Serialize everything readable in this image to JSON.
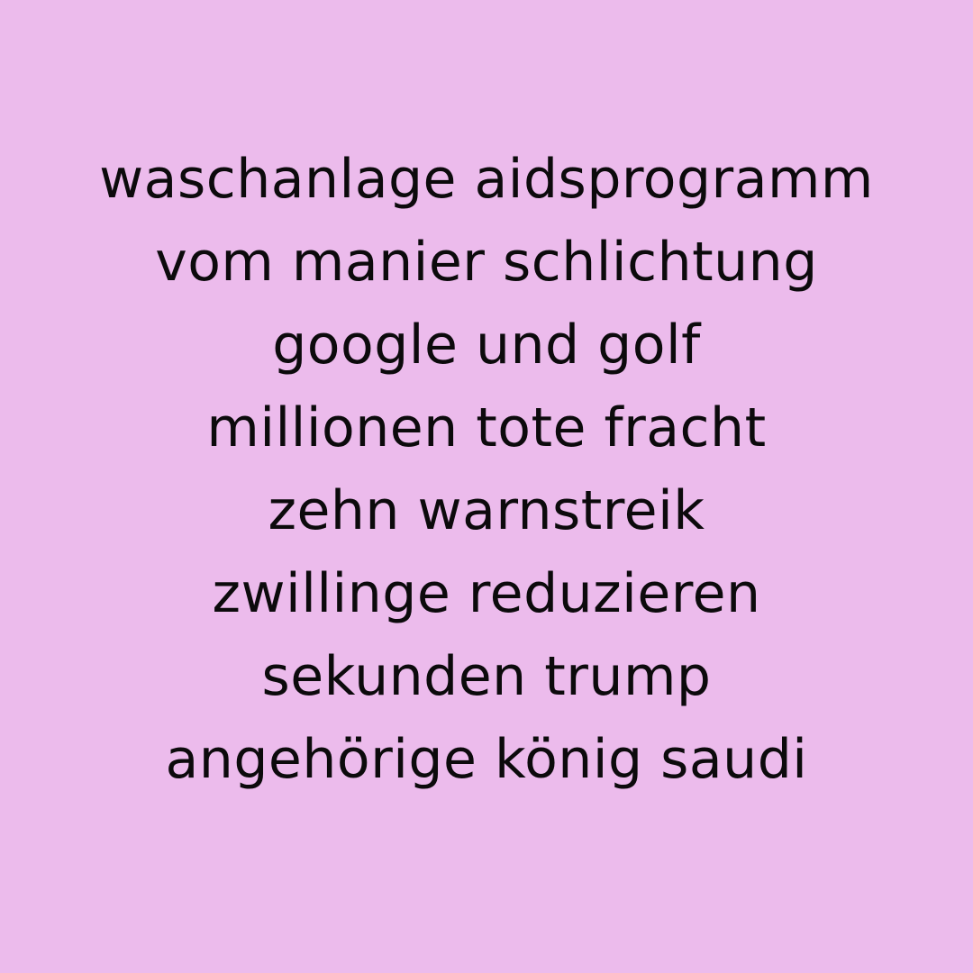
{
  "colors": {
    "background": "#ecbbec",
    "text": "#0c0a0c"
  },
  "poem": {
    "lines": [
      "waschanlage aidsprogramm",
      "vom manier schlichtung",
      "google und golf",
      "millionen tote fracht",
      "zehn warnstreik",
      "zwillinge reduzieren",
      "sekunden trump",
      "angehörige könig saudi"
    ]
  }
}
